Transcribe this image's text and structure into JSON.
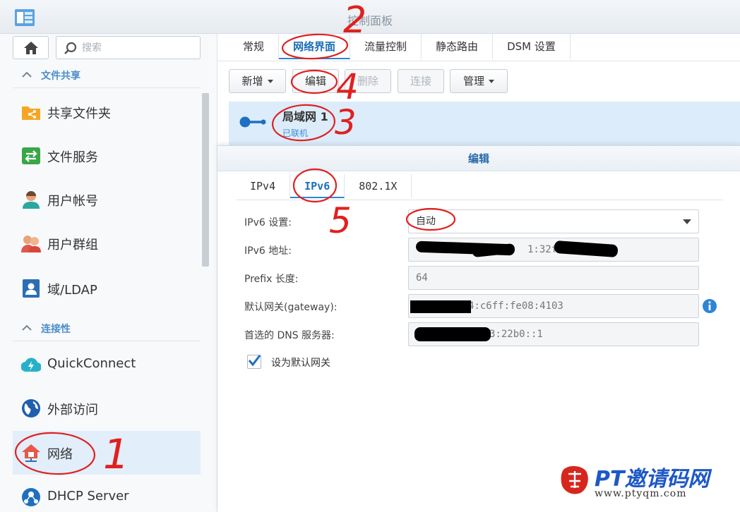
{
  "window": {
    "title": "控制面板"
  },
  "sidebar": {
    "search_placeholder": "搜索",
    "sections": [
      {
        "label": "文件共享"
      },
      {
        "label": "连接性"
      }
    ],
    "items": [
      {
        "label": "共享文件夹",
        "icon": "shared-folder-icon"
      },
      {
        "label": "文件服务",
        "icon": "file-services-icon"
      },
      {
        "label": "用户帐号",
        "icon": "user-icon"
      },
      {
        "label": "用户群组",
        "icon": "group-icon"
      },
      {
        "label": "域/LDAP",
        "icon": "domain-ldap-icon"
      },
      {
        "label": "QuickConnect",
        "icon": "quickconnect-icon"
      },
      {
        "label": "外部访问",
        "icon": "globe-icon"
      },
      {
        "label": "网络",
        "icon": "network-icon",
        "active": true
      },
      {
        "label": "DHCP Server",
        "icon": "dhcp-icon"
      }
    ]
  },
  "main": {
    "tabs": [
      "常规",
      "网络界面",
      "流量控制",
      "静态路由",
      "DSM 设置"
    ],
    "active_tab": "网络界面",
    "toolbar": {
      "add": "新增",
      "edit": "编辑",
      "delete": "删除",
      "connect": "连接",
      "manage": "管理"
    },
    "interface": {
      "name": "局域网 1",
      "status": "已联机"
    }
  },
  "dialog": {
    "title": "编辑",
    "tabs": [
      "IPv4",
      "IPv6",
      "802.1X"
    ],
    "active_tab": "IPv6",
    "fields": {
      "ipv6_setting": {
        "label": "IPv6 设置:",
        "value": "自动"
      },
      "ipv6_address": {
        "label": "IPv6 地址:",
        "value": "1:32ff:"
      },
      "prefix_length": {
        "label": "Prefix 长度:",
        "value": "64"
      },
      "gateway": {
        "label": "默认网关(gateway):",
        "value": "4:c6ff:fe08:4103"
      },
      "dns": {
        "label": "首选的 DNS 服务器:",
        "value": "3:22b0::1"
      }
    },
    "default_gateway_checkbox": {
      "label": "设为默认网关",
      "checked": true
    }
  },
  "annotations": [
    "1",
    "2",
    "3",
    "4",
    "5"
  ],
  "watermark": {
    "brand": "PT邀请码网",
    "url": "www.ptyqm.com"
  },
  "colors": {
    "accent": "#2d86d4",
    "active_row": "#dcecfa",
    "annotation": "#e0201f"
  }
}
